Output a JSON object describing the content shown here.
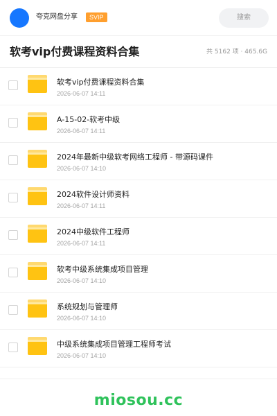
{
  "header": {
    "brand": "夸克网盘分享",
    "badge": "SVIP",
    "search_label": "搜索"
  },
  "folder": {
    "title": "软考vip付费课程资料合集",
    "summary": "共 5162 项 · 465.6G"
  },
  "items": [
    {
      "name": "软考vip付费课程资料合集",
      "date": "2026-06-07 14:11"
    },
    {
      "name": "A-15-02-软考中级",
      "date": "2026-06-07 14:11"
    },
    {
      "name": "2024年最新中级软考网络工程师 - 带源码课件",
      "date": "2026-06-07 14:10"
    },
    {
      "name": "2024软件设计师资料",
      "date": "2026-06-07 14:11"
    },
    {
      "name": "2024中级软件工程师",
      "date": "2026-06-07 14:11"
    },
    {
      "name": "软考中级系统集成项目管理",
      "date": "2026-06-07 14:10"
    },
    {
      "name": "系统规划与管理师",
      "date": "2026-06-07 14:10"
    },
    {
      "name": "中级系统集成项目管理工程师考试",
      "date": "2026-06-07 14:10"
    }
  ],
  "watermark": "miosou.cc",
  "colors": {
    "accent_blue": "#1677ff",
    "svip_orange": "#ff9f2e",
    "folder_yellow": "#ffc312",
    "watermark_green": "#2fc25b"
  },
  "icons": {
    "avatar": "avatar-circle",
    "folder": "folder-icon",
    "checkbox": "checkbox-empty"
  }
}
